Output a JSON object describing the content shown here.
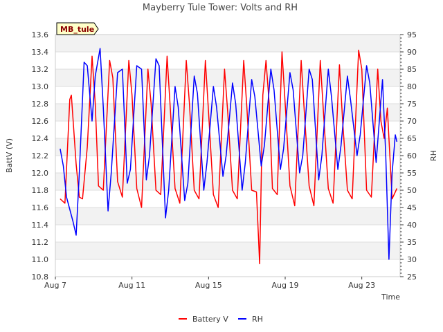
{
  "chart_data": {
    "type": "line",
    "title": "Mayberry Tule Tower: Volts and RH",
    "site_badge": "MB_tule",
    "xlabel": "Time",
    "ylabel_left": "BattV (V)",
    "ylabel_right": "RH",
    "x_range": [
      "2024-08-07",
      "2024-08-25"
    ],
    "x_ticks": [
      {
        "date": "2024-08-07",
        "label": "Aug 7"
      },
      {
        "date": "2024-08-11",
        "label": "Aug 11"
      },
      {
        "date": "2024-08-15",
        "label": "Aug 15"
      },
      {
        "date": "2024-08-19",
        "label": "Aug 19"
      },
      {
        "date": "2024-08-23",
        "label": "Aug 23"
      }
    ],
    "ylim_left": [
      10.8,
      13.6
    ],
    "y_ticks_left": [
      "10.8",
      "11.0",
      "11.2",
      "11.4",
      "11.6",
      "11.8",
      "12.0",
      "12.2",
      "12.4",
      "12.6",
      "12.8",
      "13.0",
      "13.2",
      "13.4",
      "13.6"
    ],
    "ylim_right": [
      25,
      95
    ],
    "y_ticks_right": [
      "25",
      "30",
      "35",
      "40",
      "45",
      "50",
      "55",
      "60",
      "65",
      "70",
      "75",
      "80",
      "85",
      "90",
      "95"
    ],
    "grid": true,
    "legend_position": "bottom-center",
    "series": [
      {
        "name": "Battery V",
        "axis": "left",
        "color": "#ff0000",
        "points": [
          [
            "2024-08-07 06:00",
            11.7
          ],
          [
            "2024-08-07 12:00",
            11.65
          ],
          [
            "2024-08-07 18:00",
            12.85
          ],
          [
            "2024-08-07 20:00",
            12.9
          ],
          [
            "2024-08-08 02:00",
            12.1
          ],
          [
            "2024-08-08 06:00",
            11.72
          ],
          [
            "2024-08-08 10:00",
            11.7
          ],
          [
            "2024-08-08 16:00",
            12.3
          ],
          [
            "2024-08-08 22:00",
            13.35
          ],
          [
            "2024-08-09 02:00",
            12.8
          ],
          [
            "2024-08-09 06:00",
            11.85
          ],
          [
            "2024-08-09 12:00",
            11.8
          ],
          [
            "2024-08-09 20:00",
            13.3
          ],
          [
            "2024-08-10 00:00",
            13.1
          ],
          [
            "2024-08-10 06:00",
            11.9
          ],
          [
            "2024-08-10 12:00",
            11.72
          ],
          [
            "2024-08-10 20:00",
            13.3
          ],
          [
            "2024-08-11 00:00",
            12.9
          ],
          [
            "2024-08-11 06:00",
            11.82
          ],
          [
            "2024-08-11 12:00",
            11.6
          ],
          [
            "2024-08-11 20:00",
            13.2
          ],
          [
            "2024-08-12 00:00",
            12.8
          ],
          [
            "2024-08-12 06:00",
            11.8
          ],
          [
            "2024-08-12 12:00",
            11.75
          ],
          [
            "2024-08-12 20:00",
            13.35
          ],
          [
            "2024-08-13 00:00",
            12.75
          ],
          [
            "2024-08-13 06:00",
            11.82
          ],
          [
            "2024-08-13 12:00",
            11.65
          ],
          [
            "2024-08-13 20:00",
            13.3
          ],
          [
            "2024-08-14 00:00",
            12.8
          ],
          [
            "2024-08-14 06:00",
            11.8
          ],
          [
            "2024-08-14 12:00",
            11.7
          ],
          [
            "2024-08-14 20:00",
            13.3
          ],
          [
            "2024-08-15 00:00",
            12.7
          ],
          [
            "2024-08-15 06:00",
            11.75
          ],
          [
            "2024-08-15 12:00",
            11.6
          ],
          [
            "2024-08-15 20:00",
            13.2
          ],
          [
            "2024-08-16 00:00",
            12.7
          ],
          [
            "2024-08-16 06:00",
            11.8
          ],
          [
            "2024-08-16 12:00",
            11.7
          ],
          [
            "2024-08-16 20:00",
            13.3
          ],
          [
            "2024-08-17 00:00",
            12.75
          ],
          [
            "2024-08-17 06:00",
            11.8
          ],
          [
            "2024-08-17 12:00",
            11.78
          ],
          [
            "2024-08-17 16:00",
            10.95
          ],
          [
            "2024-08-17 20:00",
            12.9
          ],
          [
            "2024-08-18 00:00",
            13.3
          ],
          [
            "2024-08-18 04:00",
            12.8
          ],
          [
            "2024-08-18 08:00",
            11.82
          ],
          [
            "2024-08-18 14:00",
            11.75
          ],
          [
            "2024-08-18 20:00",
            13.4
          ],
          [
            "2024-08-19 00:00",
            12.8
          ],
          [
            "2024-08-19 06:00",
            11.85
          ],
          [
            "2024-08-19 12:00",
            11.62
          ],
          [
            "2024-08-19 20:00",
            13.3
          ],
          [
            "2024-08-20 00:00",
            12.7
          ],
          [
            "2024-08-20 06:00",
            11.85
          ],
          [
            "2024-08-20 12:00",
            11.62
          ],
          [
            "2024-08-20 20:00",
            13.3
          ],
          [
            "2024-08-21 00:00",
            12.7
          ],
          [
            "2024-08-21 06:00",
            11.82
          ],
          [
            "2024-08-21 12:00",
            11.65
          ],
          [
            "2024-08-21 20:00",
            13.25
          ],
          [
            "2024-08-22 00:00",
            12.6
          ],
          [
            "2024-08-22 06:00",
            11.8
          ],
          [
            "2024-08-22 12:00",
            11.7
          ],
          [
            "2024-08-22 20:00",
            13.42
          ],
          [
            "2024-08-23 00:00",
            13.2
          ],
          [
            "2024-08-23 06:00",
            11.8
          ],
          [
            "2024-08-23 12:00",
            11.72
          ],
          [
            "2024-08-23 20:00",
            13.2
          ],
          [
            "2024-08-24 00:00",
            12.6
          ],
          [
            "2024-08-24 04:00",
            12.4
          ],
          [
            "2024-08-24 08:00",
            12.75
          ],
          [
            "2024-08-24 14:00",
            11.7
          ],
          [
            "2024-08-24 20:00",
            11.82
          ]
        ]
      },
      {
        "name": "RH",
        "axis": "right",
        "color": "#0000ff",
        "points": [
          [
            "2024-08-07 06:00",
            62
          ],
          [
            "2024-08-07 10:00",
            57
          ],
          [
            "2024-08-07 14:00",
            48
          ],
          [
            "2024-08-07 22:00",
            41
          ],
          [
            "2024-08-08 02:00",
            37
          ],
          [
            "2024-08-08 06:00",
            55
          ],
          [
            "2024-08-08 12:00",
            87
          ],
          [
            "2024-08-08 16:00",
            86
          ],
          [
            "2024-08-08 22:00",
            70
          ],
          [
            "2024-08-09 02:00",
            83
          ],
          [
            "2024-08-09 08:00",
            91
          ],
          [
            "2024-08-09 12:00",
            74
          ],
          [
            "2024-08-09 18:00",
            44
          ],
          [
            "2024-08-09 22:00",
            55
          ],
          [
            "2024-08-10 06:00",
            84
          ],
          [
            "2024-08-10 12:00",
            85
          ],
          [
            "2024-08-10 18:00",
            52
          ],
          [
            "2024-08-10 22:00",
            56
          ],
          [
            "2024-08-11 06:00",
            86
          ],
          [
            "2024-08-11 12:00",
            85
          ],
          [
            "2024-08-11 18:00",
            53
          ],
          [
            "2024-08-11 22:00",
            60
          ],
          [
            "2024-08-12 06:00",
            88
          ],
          [
            "2024-08-12 10:00",
            86
          ],
          [
            "2024-08-12 18:00",
            42
          ],
          [
            "2024-08-12 22:00",
            50
          ],
          [
            "2024-08-13 06:00",
            80
          ],
          [
            "2024-08-13 10:00",
            74
          ],
          [
            "2024-08-13 18:00",
            47
          ],
          [
            "2024-08-13 22:00",
            52
          ],
          [
            "2024-08-14 06:00",
            83
          ],
          [
            "2024-08-14 10:00",
            78
          ],
          [
            "2024-08-14 18:00",
            50
          ],
          [
            "2024-08-14 22:00",
            58
          ],
          [
            "2024-08-15 06:00",
            80
          ],
          [
            "2024-08-15 10:00",
            74
          ],
          [
            "2024-08-15 18:00",
            54
          ],
          [
            "2024-08-15 22:00",
            60
          ],
          [
            "2024-08-16 06:00",
            81
          ],
          [
            "2024-08-16 10:00",
            75
          ],
          [
            "2024-08-16 18:00",
            50
          ],
          [
            "2024-08-16 22:00",
            58
          ],
          [
            "2024-08-17 06:00",
            82
          ],
          [
            "2024-08-17 10:00",
            77
          ],
          [
            "2024-08-17 18:00",
            57
          ],
          [
            "2024-08-17 22:00",
            63
          ],
          [
            "2024-08-18 06:00",
            85
          ],
          [
            "2024-08-18 10:00",
            79
          ],
          [
            "2024-08-18 18:00",
            56
          ],
          [
            "2024-08-18 22:00",
            62
          ],
          [
            "2024-08-19 06:00",
            84
          ],
          [
            "2024-08-19 10:00",
            79
          ],
          [
            "2024-08-19 18:00",
            55
          ],
          [
            "2024-08-19 22:00",
            60
          ],
          [
            "2024-08-20 06:00",
            85
          ],
          [
            "2024-08-20 10:00",
            82
          ],
          [
            "2024-08-20 18:00",
            53
          ],
          [
            "2024-08-20 22:00",
            60
          ],
          [
            "2024-08-21 06:00",
            85
          ],
          [
            "2024-08-21 10:00",
            77
          ],
          [
            "2024-08-21 18:00",
            56
          ],
          [
            "2024-08-21 22:00",
            63
          ],
          [
            "2024-08-22 06:00",
            83
          ],
          [
            "2024-08-22 10:00",
            76
          ],
          [
            "2024-08-22 18:00",
            60
          ],
          [
            "2024-08-22 22:00",
            66
          ],
          [
            "2024-08-23 06:00",
            86
          ],
          [
            "2024-08-23 10:00",
            81
          ],
          [
            "2024-08-23 18:00",
            58
          ],
          [
            "2024-08-24 02:00",
            82
          ],
          [
            "2024-08-24 06:00",
            60
          ],
          [
            "2024-08-24 10:00",
            30
          ],
          [
            "2024-08-24 14:00",
            55
          ],
          [
            "2024-08-24 18:00",
            66
          ],
          [
            "2024-08-24 20:00",
            64
          ]
        ]
      }
    ]
  }
}
